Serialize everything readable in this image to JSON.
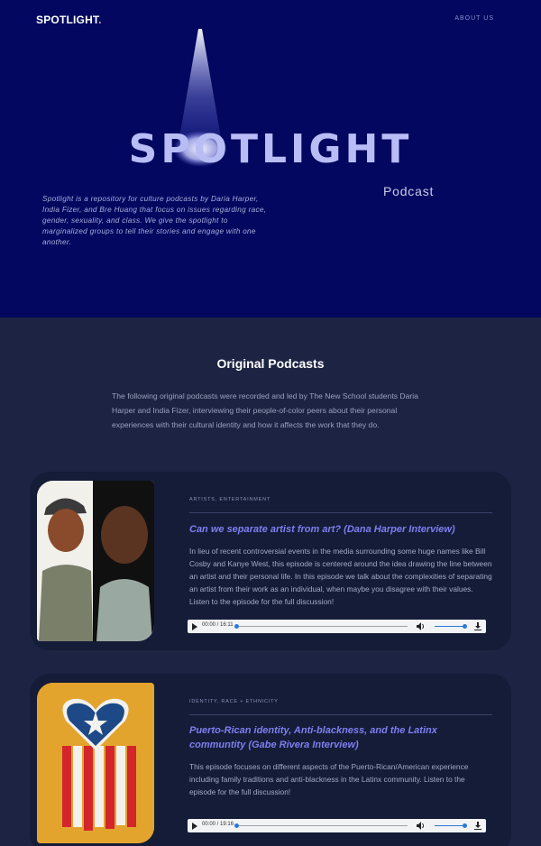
{
  "nav": {
    "logo_text": "SPOTLIGHT",
    "logo_dot": ".",
    "about": "ABOUT US"
  },
  "hero": {
    "wordmark": "SPOTLIGHT",
    "subtitle": "Podcast",
    "description": "Spotlight is a repository for culture podcasts by Daria Harper, India Fizer, and Bre Huang that focus on issues regarding race, gender, sexuality, and class. We give the spotlight to marginalized groups to tell their stories and engage with one another."
  },
  "section": {
    "title": "Original Podcasts",
    "intro": "The following original podcasts were recorded and led by The New School students Daria Harper and India Fizer, interviewing their people-of-color peers about their personal experiences with their cultural identity and how it affects the work that they do."
  },
  "episodes": [
    {
      "tags": "ARTISTS, ENTERTAINMENT",
      "title": "Can we separate artist from art? (Dana Harper Interview)",
      "description": "In lieu of recent controversial events in the media surrounding some huge names like Bill Cosby and Kanye West, this episode is centered around the idea drawing the line between an artist and their personal life. In this episode we talk about the complexities of separating an artist from their work as an individual, when maybe you disagree with their values. Listen to the episode for the full discussion!",
      "time": "00:00 / 16:11"
    },
    {
      "tags": "IDENTITY, RACE + ETHNICITY",
      "title": "Puerto-Rican identity, Anti-blackness, and the Latinx communtity (Gabe Rivera Interview)",
      "description": "This episode focuses on different aspects of the Puerto-Rican/American experience including family traditions and anti-blackness in the Latinx community. Listen to the episode for the full discussion!",
      "time": "00:00 / 19:16"
    }
  ],
  "colors": {
    "hero_bg": "#03075f",
    "page_bg": "#1d2443",
    "card_bg": "#141c38",
    "accent": "#7f7ff0"
  }
}
